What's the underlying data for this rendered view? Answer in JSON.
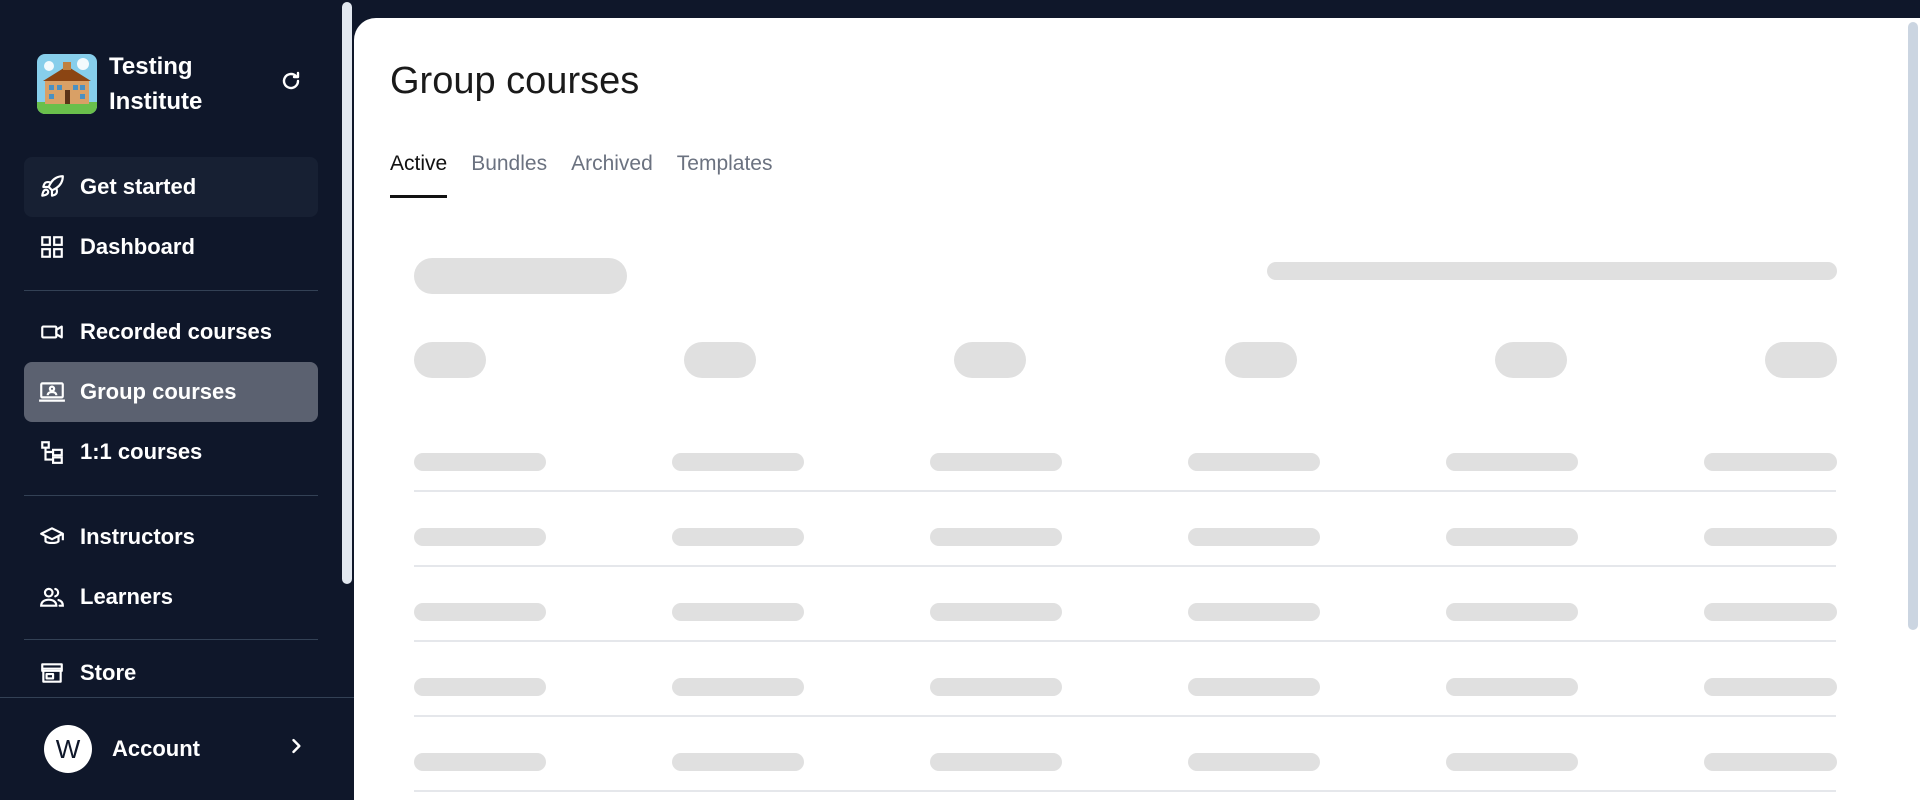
{
  "brand": {
    "name": "Testing Institute"
  },
  "sidebar": {
    "items": [
      {
        "label": "Get started",
        "icon": "rocket-icon"
      },
      {
        "label": "Dashboard",
        "icon": "grid-icon"
      },
      {
        "label": "Recorded courses",
        "icon": "video-camera-icon"
      },
      {
        "label": "Group courses",
        "icon": "presentation-icon",
        "active": true
      },
      {
        "label": "1:1 courses",
        "icon": "hierarchy-icon"
      },
      {
        "label": "Instructors",
        "icon": "graduation-cap-icon"
      },
      {
        "label": "Learners",
        "icon": "users-icon"
      },
      {
        "label": "Store",
        "icon": "store-icon"
      }
    ]
  },
  "account": {
    "initial": "W",
    "label": "Account"
  },
  "page": {
    "title": "Group courses",
    "tabs": [
      "Active",
      "Bundles",
      "Archived",
      "Templates"
    ],
    "active_tab": "Active",
    "loading": true
  },
  "colors": {
    "sidebar_bg": "#0f172a",
    "active_item_bg": "#5b6170",
    "skeleton": "#e0e0e0"
  }
}
